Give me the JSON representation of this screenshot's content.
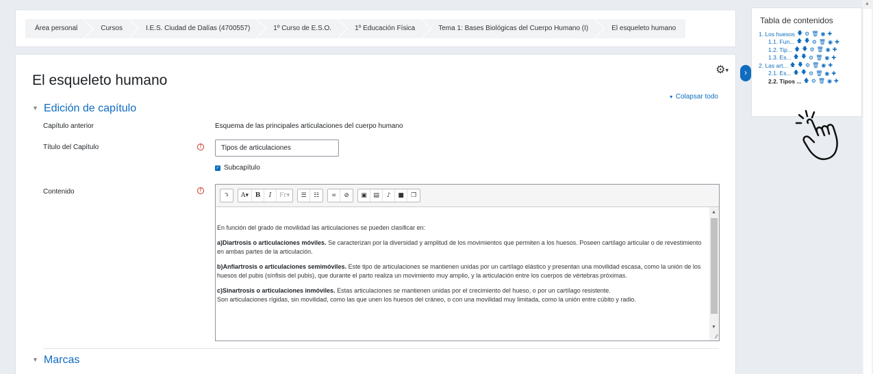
{
  "breadcrumb": [
    "Área personal",
    "Cursos",
    "I.E.S. Ciudad de Dalías (4700557)",
    "1º Curso de E.S.O.",
    "1º Educación Física",
    "Tema 1: Bases Biológicas del Cuerpo Humano (I)",
    "El esqueleto humano"
  ],
  "page": {
    "title": "El esqueleto humano",
    "collapse_all": "Colapsar todo",
    "section_edit": "Edición de capítulo",
    "section_tags": "Marcas"
  },
  "form": {
    "prev_label": "Capítulo anterior",
    "prev_value": "Esquema de las principales articulaciones del cuerpo humano",
    "title_label": "Título del Capítulo",
    "title_value": "Tipos de articulaciones",
    "subchapter_label": "Subcapítulo",
    "content_label": "Contenido"
  },
  "editor": {
    "toolbar": [
      "↴",
      "A▾",
      "B",
      "I",
      "Fr▾",
      "bullet-list",
      "numbered-list",
      "link",
      "unlink",
      "image",
      "media",
      "microphone",
      "video",
      "copy"
    ],
    "intro": "En función del grado de movilidad las articulaciones se pueden clasificar en:",
    "a_bold": "a)Diartrosis o articulaciones móviles.",
    "a_text": " Se caracterizan por la diversidad y amplitud de los movimientos que permiten a los huesos. Poseen cartílago articular o de revestimiento en ambas partes de la articulación.",
    "b_bold": "b)Anfiartrosis o articulaciones semimóviles.",
    "b_text": " Este tipo de articulaciones se mantienen unidas por un cartílago elástico y presentan una movilidad escasa, como la unión de los huesos del pubis (sínfisis del pubis), que durante el parto realiza un movimiento muy amplio, y la articulación entre los cuerpos de vértebras próximas.",
    "c_bold": "c)Sinartrosis o articulaciones inmóviles.",
    "c_text": " Estas articulaciones se mantienen unidas por el crecimiento del hueso, o por un cartílago resistente.",
    "c_text2": "Son articulaciones rígidas, sin movilidad, como las que unen los huesos del cráneo, o con una movilidad muy limitada, como la unión entre cúbito y radio."
  },
  "toc": {
    "title": "Tabla de contenidos",
    "items": [
      {
        "label": "1. Los huesos",
        "indent": 0,
        "icons": [
          "↓",
          "⚙",
          "🗑",
          "👁",
          "+"
        ]
      },
      {
        "label": "1.1. Fun...",
        "indent": 1,
        "icons": [
          "↑",
          "↓",
          "⚙",
          "🗑",
          "👁",
          "+"
        ]
      },
      {
        "label": "1.2. Tip...",
        "indent": 1,
        "icons": [
          "↑",
          "↓",
          "⚙",
          "🗑",
          "👁",
          "+"
        ]
      },
      {
        "label": "1.3. Es...",
        "indent": 1,
        "icons": [
          "↑",
          "↓",
          "⚙",
          "🗑",
          "👁",
          "+"
        ]
      },
      {
        "label": "2. Las art...",
        "indent": 0,
        "icons": [
          "↑",
          "↓",
          "⚙",
          "🗑",
          "👁",
          "+"
        ]
      },
      {
        "label": "2.1. Es...",
        "indent": 1,
        "icons": [
          "↑",
          "↓",
          "⚙",
          "🗑",
          "👁",
          "+"
        ]
      },
      {
        "label": "2.2. Tipos ...",
        "indent": 1,
        "current": true,
        "icons": [
          "↑",
          "⚙",
          "🗑",
          "👁",
          "+"
        ]
      }
    ]
  },
  "colors": {
    "accent": "#0f6cbf",
    "required": "#ca3120",
    "background": "#e9ecf1"
  }
}
